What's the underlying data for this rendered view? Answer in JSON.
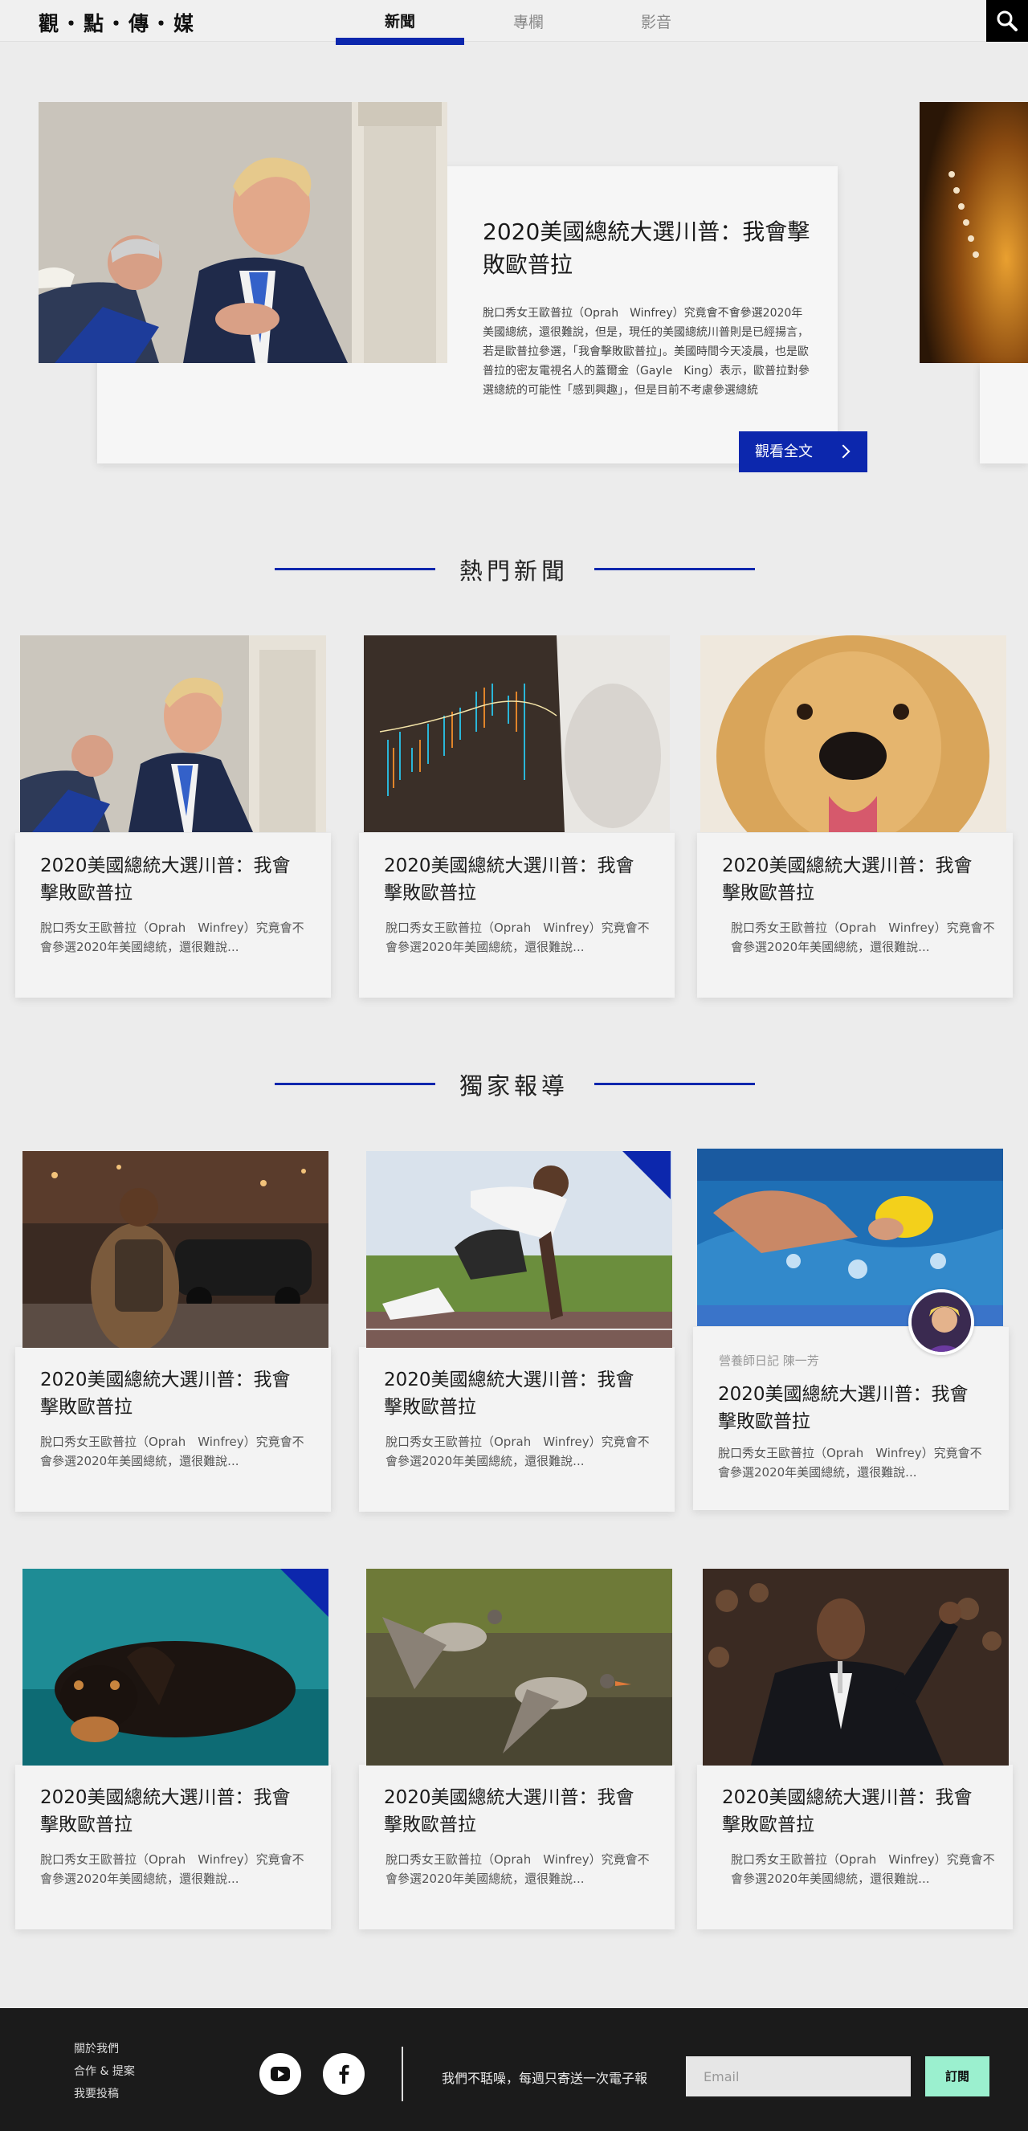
{
  "header": {
    "logo": "觀‧點‧傳‧媒",
    "tabs": [
      {
        "label": "新聞",
        "active": true
      },
      {
        "label": "專欄",
        "active": false
      },
      {
        "label": "影音",
        "active": false
      }
    ],
    "search_icon": "search-icon"
  },
  "hero": {
    "title": "2020美國總統大選川普：我會擊敗歐普拉",
    "text": "脫口秀女王歐普拉（Oprah　Winfrey）究竟會不會參選2020年美國總統，還很難說，但是，現任的美國總統川普則是已經揚言，若是歐普拉參選，「我會擊敗歐普拉」。美國時間今天凌晨，也是歐普拉的密友電視名人的蓋爾金（Gayle　King）表示，歐普拉對參選總統的可能性「感到興趣」，但是目前不考慮參選總統",
    "button_label": "觀看全文"
  },
  "sections": {
    "hot": "熱門新聞",
    "exclusive": "獨家報導"
  },
  "hot_news": [
    {
      "title": "2020美國總統大選川普：我會擊敗歐普拉",
      "excerpt": "脫口秀女王歐普拉（Oprah　Winfrey）究竟會不會參選2020年美國總統，還很難說..."
    },
    {
      "title": "2020美國總統大選川普：我會擊敗歐普拉",
      "excerpt": "脫口秀女王歐普拉（Oprah　Winfrey）究竟會不會參選2020年美國總統，還很難說..."
    },
    {
      "title": "2020美國總統大選川普：我會擊敗歐普拉",
      "excerpt": "脫口秀女王歐普拉（Oprah　Winfrey）究竟會不會參選2020年美國總統，還很難說..."
    }
  ],
  "exclusive": [
    {
      "title": "2020美國總統大選川普：我會擊敗歐普拉",
      "excerpt": "脫口秀女王歐普拉（Oprah　Winfrey）究竟會不會參選2020年美國總統，還很難說..."
    },
    {
      "title": "2020美國總統大選川普：我會擊敗歐普拉",
      "excerpt": "脫口秀女王歐普拉（Oprah　Winfrey）究竟會不會參選2020年美國總統，還很難說..."
    },
    {
      "title": "2020美國總統大選川普：我會擊敗歐普拉",
      "excerpt": "脫口秀女王歐普拉（Oprah　Winfrey）究竟會不會參選2020年美國總統，還很難說...",
      "author": "營養師日記 陳一芳"
    },
    {
      "title": "2020美國總統大選川普：我會擊敗歐普拉",
      "excerpt": "脫口秀女王歐普拉（Oprah　Winfrey）究竟會不會參選2020年美國總統，還很難說..."
    },
    {
      "title": "2020美國總統大選川普：我會擊敗歐普拉",
      "excerpt": "脫口秀女王歐普拉（Oprah　Winfrey）究竟會不會參選2020年美國總統，還很難說..."
    },
    {
      "title": "2020美國總統大選川普：我會擊敗歐普拉",
      "excerpt": "脫口秀女王歐普拉（Oprah　Winfrey）究竟會不會參選2020年美國總統，還很難說..."
    }
  ],
  "footer": {
    "links": [
      "關於我們",
      "合作 & 提案",
      "我要投稿"
    ],
    "social": [
      "youtube-icon",
      "facebook-icon"
    ],
    "newsletter_text": "我們不聒噪，每週只寄送一次電子報",
    "email_placeholder": "Email",
    "subscribe_label": "訂閱"
  },
  "colors": {
    "accent": "#0c27ad",
    "subscribe": "#9bf0cf",
    "footer_bg": "#1b1b1b"
  }
}
